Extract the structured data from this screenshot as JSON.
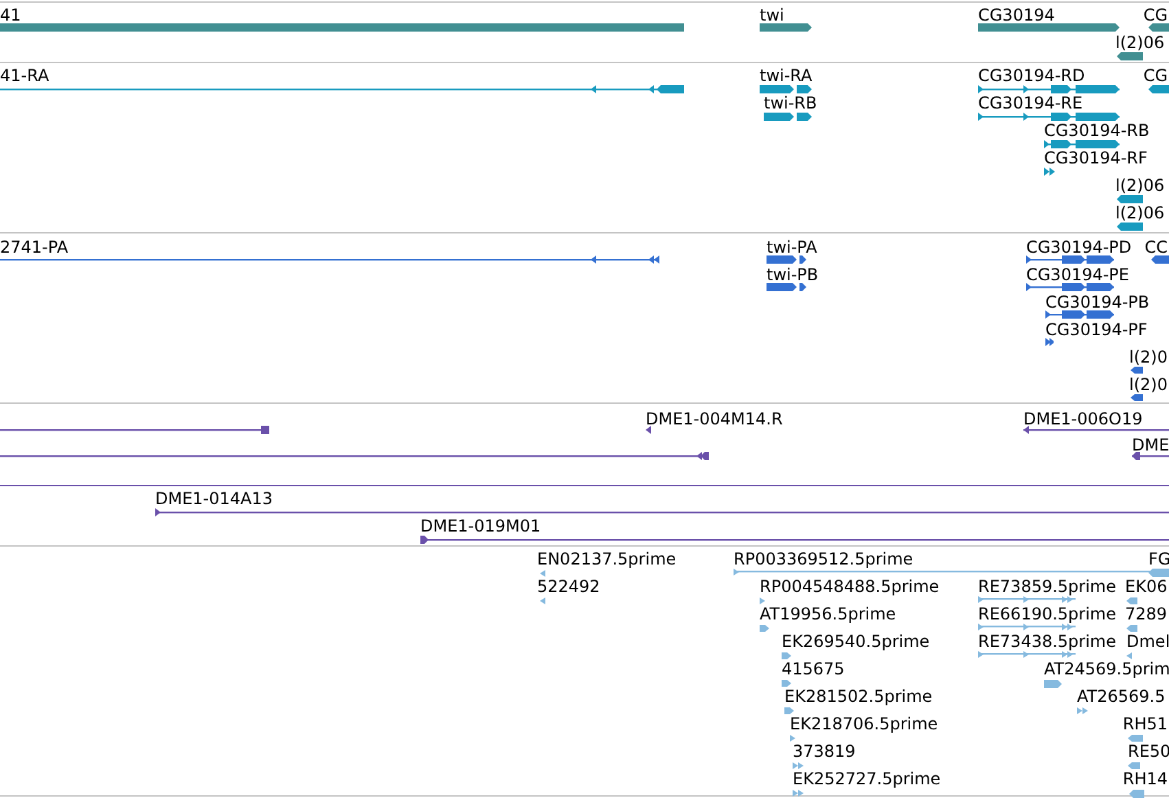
{
  "tracks": [
    {
      "features": [
        {
          "label": "41"
        },
        {
          "label": "twi"
        },
        {
          "label": "CG30194"
        },
        {
          "label": "CG"
        },
        {
          "label": "l(2)06"
        }
      ]
    },
    {
      "features": [
        {
          "label": "41-RA"
        },
        {
          "label": "twi-RA"
        },
        {
          "label": "twi-RB"
        },
        {
          "label": "CG30194-RD"
        },
        {
          "label": "CG30194-RE"
        },
        {
          "label": "CG30194-RB"
        },
        {
          "label": "CG30194-RF"
        },
        {
          "label": "CG"
        },
        {
          "label": "l(2)06"
        },
        {
          "label": "l(2)06"
        }
      ]
    },
    {
      "features": [
        {
          "label": "2741-PA"
        },
        {
          "label": "twi-PA"
        },
        {
          "label": "twi-PB"
        },
        {
          "label": "CG30194-PD"
        },
        {
          "label": "CG30194-PE"
        },
        {
          "label": "CG30194-PB"
        },
        {
          "label": "CG30194-PF"
        },
        {
          "label": "CC"
        },
        {
          "label": "l(2)0"
        },
        {
          "label": "l(2)0"
        }
      ]
    },
    {
      "features": [
        {
          "label": "DME1-004M14.R"
        },
        {
          "label": "DME1-006O19"
        },
        {
          "label": "DME"
        },
        {
          "label": "DME1-014A13"
        },
        {
          "label": "DME1-019M01"
        }
      ]
    },
    {
      "features": [
        {
          "label": "EN02137.5prime"
        },
        {
          "label": "522492"
        },
        {
          "label": "RP003369512.5prime"
        },
        {
          "label": "FG"
        },
        {
          "label": "RP004548488.5prime"
        },
        {
          "label": "AT19956.5prime"
        },
        {
          "label": "EK269540.5prime"
        },
        {
          "label": "415675"
        },
        {
          "label": "EK281502.5prime"
        },
        {
          "label": "EK218706.5prime"
        },
        {
          "label": "373819"
        },
        {
          "label": "EK252727.5prime"
        },
        {
          "label": "RE73859.5prime"
        },
        {
          "label": "RE66190.5prime"
        },
        {
          "label": "RE73438.5prime"
        },
        {
          "label": "EK06"
        },
        {
          "label": "7289"
        },
        {
          "label": "Dmel"
        },
        {
          "label": "AT24569.5prim"
        },
        {
          "label": "AT26569.5"
        },
        {
          "label": "RH51"
        },
        {
          "label": "RE50"
        },
        {
          "label": "RH14"
        }
      ]
    }
  ]
}
